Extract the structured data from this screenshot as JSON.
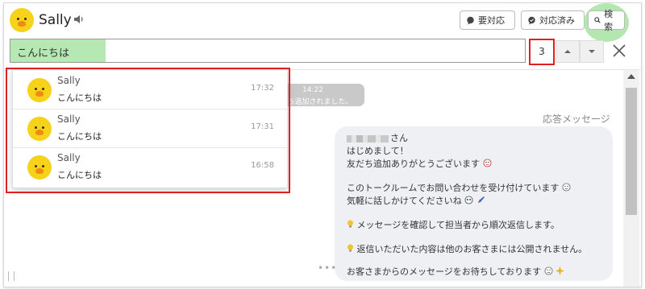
{
  "header": {
    "contact_name": "Sally",
    "buttons": {
      "todo": "要対応",
      "done": "対応済み",
      "search": "検索"
    }
  },
  "search": {
    "value": "こんにちは",
    "result_count": "3"
  },
  "chat": {
    "system_time": "14:22",
    "system_text": "友だち追加されました。",
    "sender_label": "応答メッセージ",
    "bubble_lines": [
      "さん",
      "はじめまして！",
      "友だち追加ありがとうございます",
      "このトークルームでお問い合わせを受け付けています",
      "気軽に話しかけてくださいね",
      "メッセージを確認して担当者から順次返信します。",
      "返信いただいた内容は他のお客さまには公開されません。",
      "お客さまからのメッセージをお待ちしております"
    ],
    "more": "•••"
  },
  "results": [
    {
      "name": "Sally",
      "text": "こんにちは",
      "time": "17:32"
    },
    {
      "name": "Sally",
      "text": "こんにちは",
      "time": "17:31"
    },
    {
      "name": "Sally",
      "text": "こんにちは",
      "time": "16:58"
    }
  ],
  "colors": {
    "search_highlight": "#b6e8b3",
    "annotation_red": "#e02020",
    "avatar_yellow": "#f6d21a",
    "bubble_bg": "#eef0f3"
  }
}
